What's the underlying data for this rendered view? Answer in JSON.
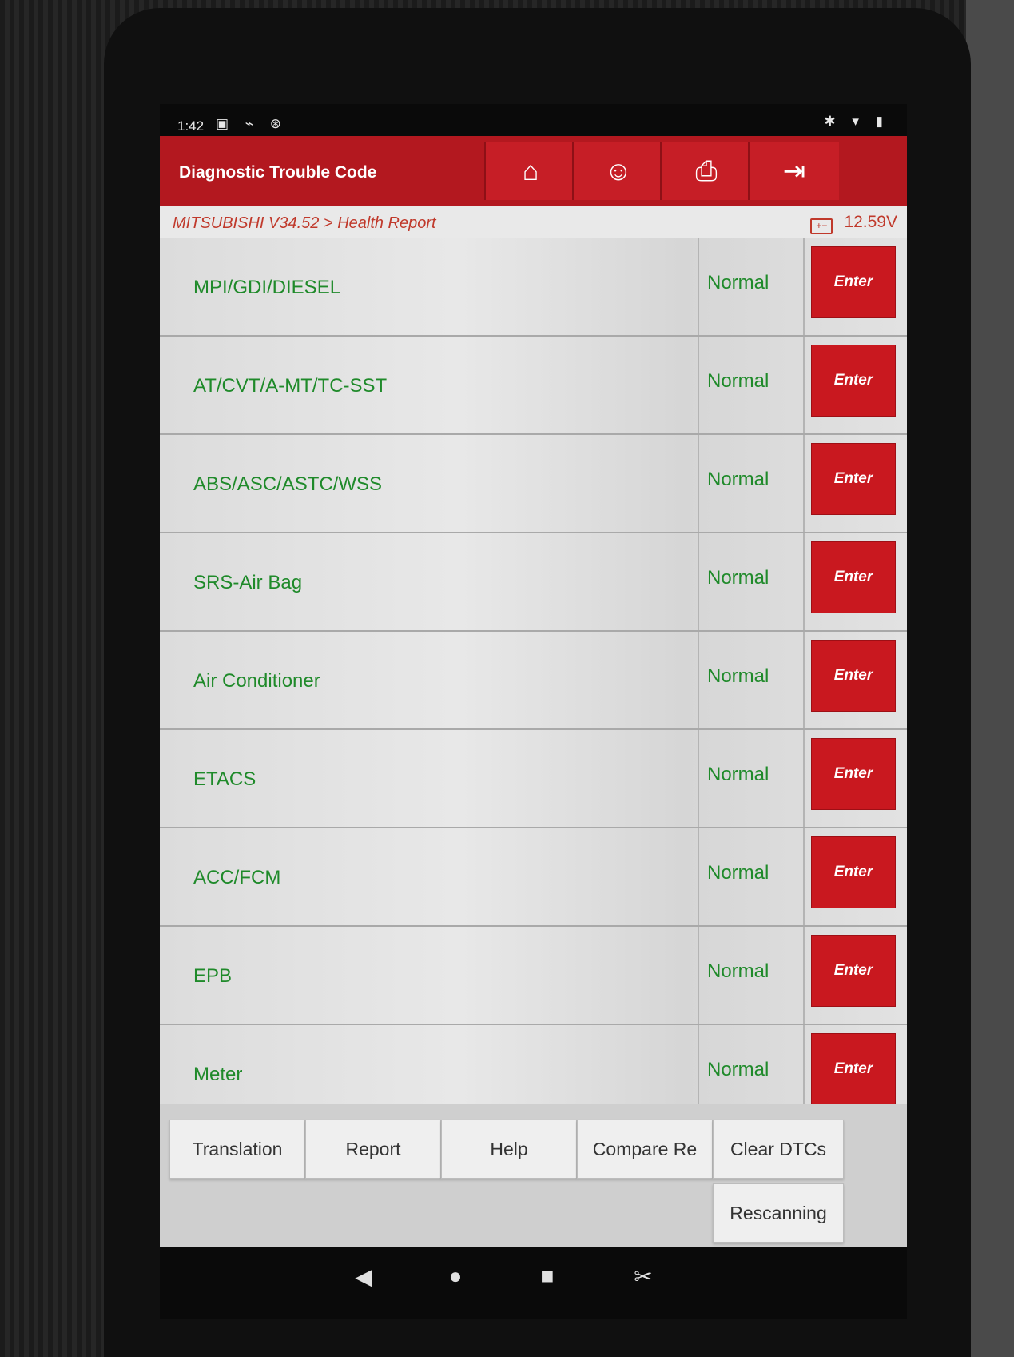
{
  "status_bar": {
    "time": "1:42",
    "left_icons": [
      "image-icon",
      "usb-icon",
      "vci-icon"
    ],
    "right_icons": [
      "bluetooth-icon",
      "wifi-icon",
      "battery-icon"
    ]
  },
  "header": {
    "title": "Diagnostic Trouble Code",
    "buttons": [
      {
        "name": "home-icon",
        "glyph": "⌂"
      },
      {
        "name": "user-icon",
        "glyph": "☺"
      },
      {
        "name": "print-icon",
        "glyph": "⎙"
      },
      {
        "name": "exit-icon",
        "glyph": "⇥"
      }
    ]
  },
  "breadcrumb": {
    "path": "MITSUBISHI V34.52 > Health Report",
    "voltage": "12.59V"
  },
  "systems": [
    {
      "name": "MPI/GDI/DIESEL",
      "status": "Normal",
      "action": "Enter"
    },
    {
      "name": "AT/CVT/A-MT/TC-SST",
      "status": "Normal",
      "action": "Enter"
    },
    {
      "name": "ABS/ASC/ASTC/WSS",
      "status": "Normal",
      "action": "Enter"
    },
    {
      "name": "SRS-Air Bag",
      "status": "Normal",
      "action": "Enter"
    },
    {
      "name": "Air Conditioner",
      "status": "Normal",
      "action": "Enter"
    },
    {
      "name": "ETACS",
      "status": "Normal",
      "action": "Enter"
    },
    {
      "name": "ACC/FCM",
      "status": "Normal",
      "action": "Enter"
    },
    {
      "name": "EPB",
      "status": "Normal",
      "action": "Enter"
    },
    {
      "name": "Meter",
      "status": "Normal",
      "action": "Enter"
    }
  ],
  "bottom_buttons": {
    "translation": "Translation",
    "report": "Report",
    "help": "Help",
    "compare": "Compare Re",
    "clear": "Clear DTCs",
    "rescan": "Rescanning"
  },
  "nav": {
    "back": "◀",
    "home": "●",
    "recents": "■",
    "screenshot": "✂"
  },
  "colors": {
    "header": "#b3181f",
    "enter_button": "#c9181f",
    "status_text": "#1f8a2a",
    "breadcrumb_text": "#c0392b"
  }
}
